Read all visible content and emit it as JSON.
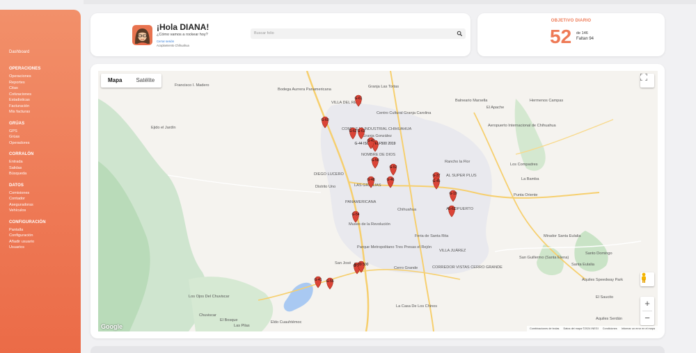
{
  "sidebar": {
    "dashboard": "Dashboard",
    "sections": [
      {
        "title": "OPERACIONES",
        "items": [
          "Operaciones",
          "Reportes",
          "Citas",
          "Cotizaciones",
          "Estadisticas",
          "Facturación",
          "Mis facturas"
        ]
      },
      {
        "title": "GRÚAS",
        "items": [
          "GPS",
          "Grúas",
          "Operadores"
        ]
      },
      {
        "title": "CORRALÓN",
        "items": [
          "Entrada",
          "Salidas",
          "Búsqueda"
        ]
      },
      {
        "title": "DATOS",
        "items": [
          "Comisiones",
          "Contador",
          "Aseguradoras",
          "Vehículos"
        ]
      },
      {
        "title": "CONFIGURACIÓN",
        "items": [
          "Pantalla",
          "Configuración",
          "Añadir usuario",
          "Usuarios"
        ]
      }
    ]
  },
  "header": {
    "greeting": "¡Hola DIANA!",
    "subtitle": "¿Cómo vamos a rockear hoy?",
    "line1": "Cerrar sesión",
    "line2": "Acoplamiento Chihuahua",
    "search_placeholder": "Buscar folio"
  },
  "objective": {
    "title": "OBJETIVO DIARIO",
    "value": "52",
    "of_total": "de 146",
    "remaining": "Faltan 94"
  },
  "map": {
    "tab_map": "Mapa",
    "tab_satellite": "Satélite",
    "active_tab": "Mapa",
    "google_logo": "Google",
    "attribution": [
      "Combinaciones de teclas",
      "Datos del mapa ©2024 INEGI",
      "Condiciones",
      "Informar un error en el mapa"
    ],
    "zoom_in": "+",
    "zoom_out": "−",
    "accent_color": "#ee7a56",
    "pin_color": "#db4437",
    "labels": [
      "Francisco I. Madero",
      "Granja Las Tortas",
      "Bodega Aurrera Panamericana",
      "Balneario Marsella",
      "Hermenos Campas",
      "El Apache",
      "VILLA DEL REAL",
      "Centro Cultural Granja Carolina",
      "Ejido el Jardín",
      "COMPLEJO INDUSTRIAL CHIHUAHUA",
      "Granja González",
      "Aeropuerto Internacional de Chihuahua",
      "NOMBRE DE DIOS",
      "Rancho la Flor",
      "Los Compadres",
      "DIEGO LUCERO",
      "LAS GRANJAS",
      "Distrito Uno",
      "AL SUPER PLUS",
      "La Bamba",
      "PANAMERICANA",
      "Chihuahua",
      "AEROPUERTO",
      "Punta Oriente",
      "Museo de la Revolución",
      "Feria de Santa Rita",
      "Mirador Santa Eulalia",
      "Parque Metropolitano Tres Presas el Rejón",
      "VILLA JUÁREZ",
      "Santo Domingo",
      "San Guillermo (Santa Elena)",
      "San José",
      "Cerro Grande",
      "CORREDOR VISTAS CERRO GRANDE",
      "Santa Eulalia",
      "Aquiles Speedway Park",
      "Los Ojos Del Chuviscar",
      "La Casa De Los Chinos",
      "El Saucito",
      "Chuviscar",
      "El Bosque",
      "Las Pilas",
      "Eldo Cuauhtémoc",
      "Aquiles Serdán"
    ],
    "pins": [
      "G-60",
      "G-61",
      "G-62",
      "G-63",
      "G-44 ISUZU ELF500 2019",
      "G-47",
      "G-58",
      "G-52",
      "G-37",
      "G-48",
      "G-46",
      "G-45",
      "G-19",
      "G-63",
      "G-54",
      "G-13",
      "G-39 500",
      "G-41",
      "G-55"
    ]
  }
}
